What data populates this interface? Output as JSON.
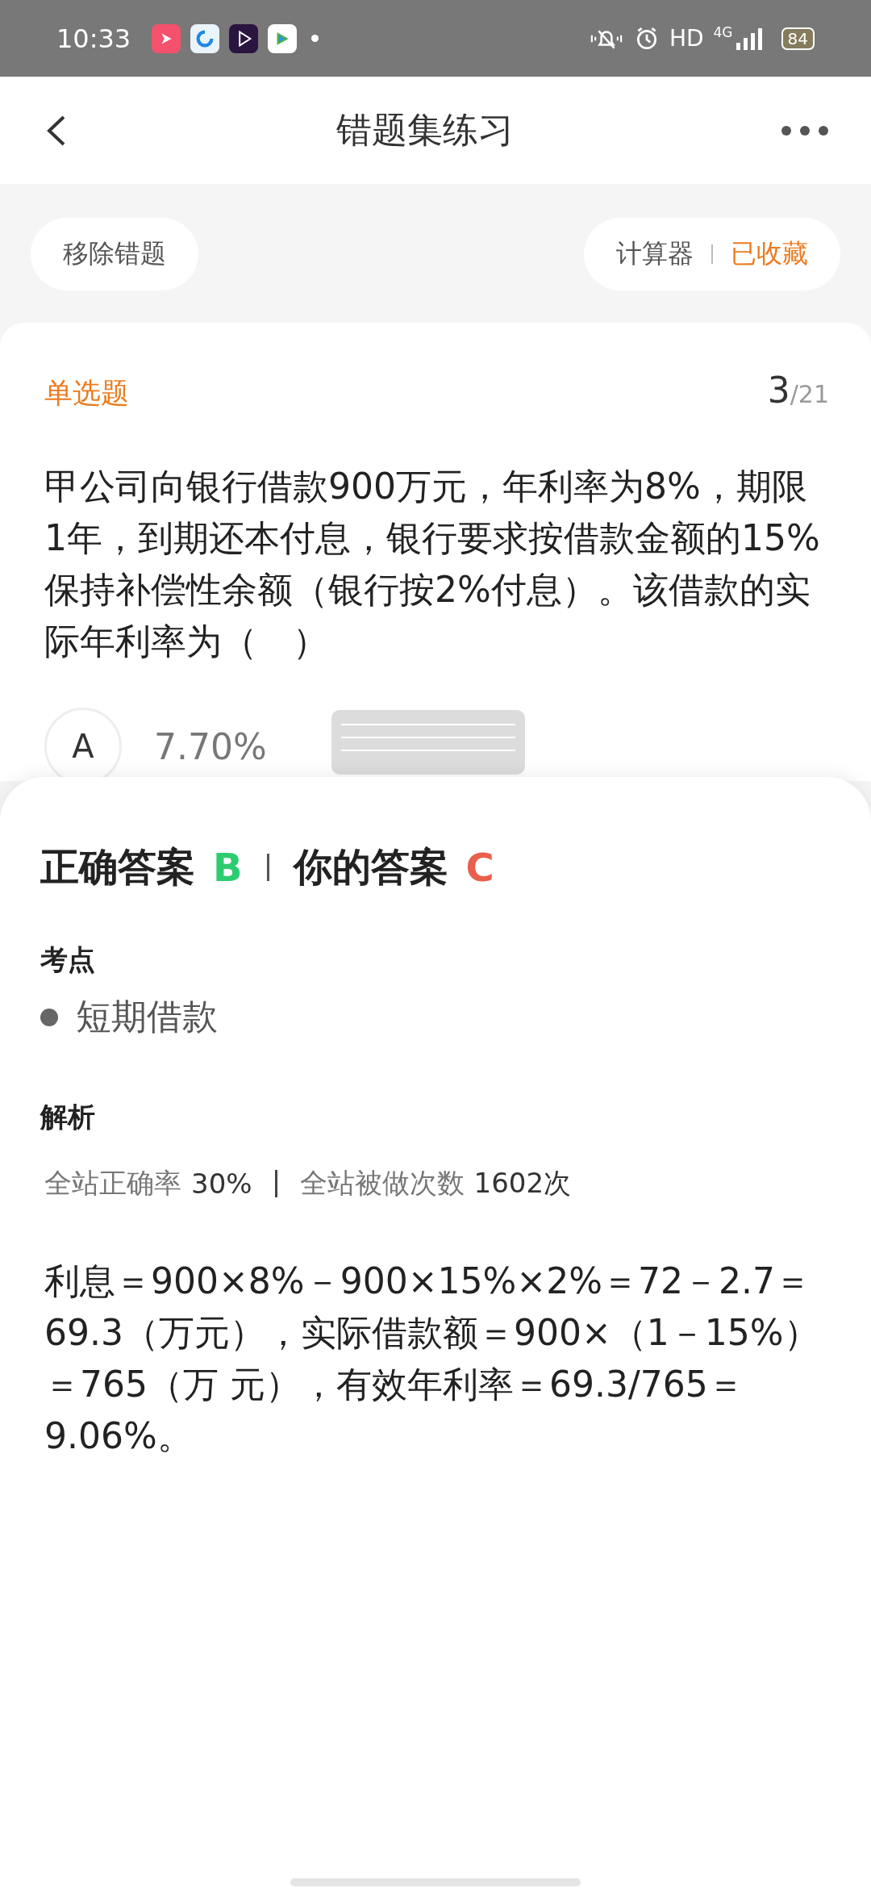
{
  "status_bar": {
    "time": "10:33",
    "hd": "HD",
    "network": "4G",
    "battery": "84"
  },
  "header": {
    "title": "错题集练习"
  },
  "toolbar": {
    "remove_button": "移除错题",
    "calculator": "计算器",
    "favorite": {
      "label": "已收藏",
      "on": true
    }
  },
  "question": {
    "type": "单选题",
    "index": "3",
    "total": "/21",
    "text": "甲公司向银行借款900万元，年利率为8%，期限1年，到期还本付息，银行要求按借款金额的15%保持补偿性余额（银行按2%付息）。该借款的实际年利率为（　）",
    "options": [
      {
        "letter": "A",
        "text": "7.70%"
      }
    ]
  },
  "answer": {
    "correct_label": "正确答案",
    "correct": "B",
    "yours_label": "你的答案",
    "yours": "C"
  },
  "knowledge": {
    "title": "考点",
    "items": [
      "短期借款"
    ]
  },
  "analysis": {
    "title": "解析",
    "stats": [
      {
        "label": "全站正确率",
        "value": "30%"
      },
      {
        "label": "全站被做次数",
        "value": "1602次"
      }
    ],
    "text": "利息＝900×8%－900×15%×2%＝72－2.7＝69.3（万元），实际借款额＝900×（1－15%）＝765（万 元），有效年利率＝69.3/765＝9.06%。"
  }
}
